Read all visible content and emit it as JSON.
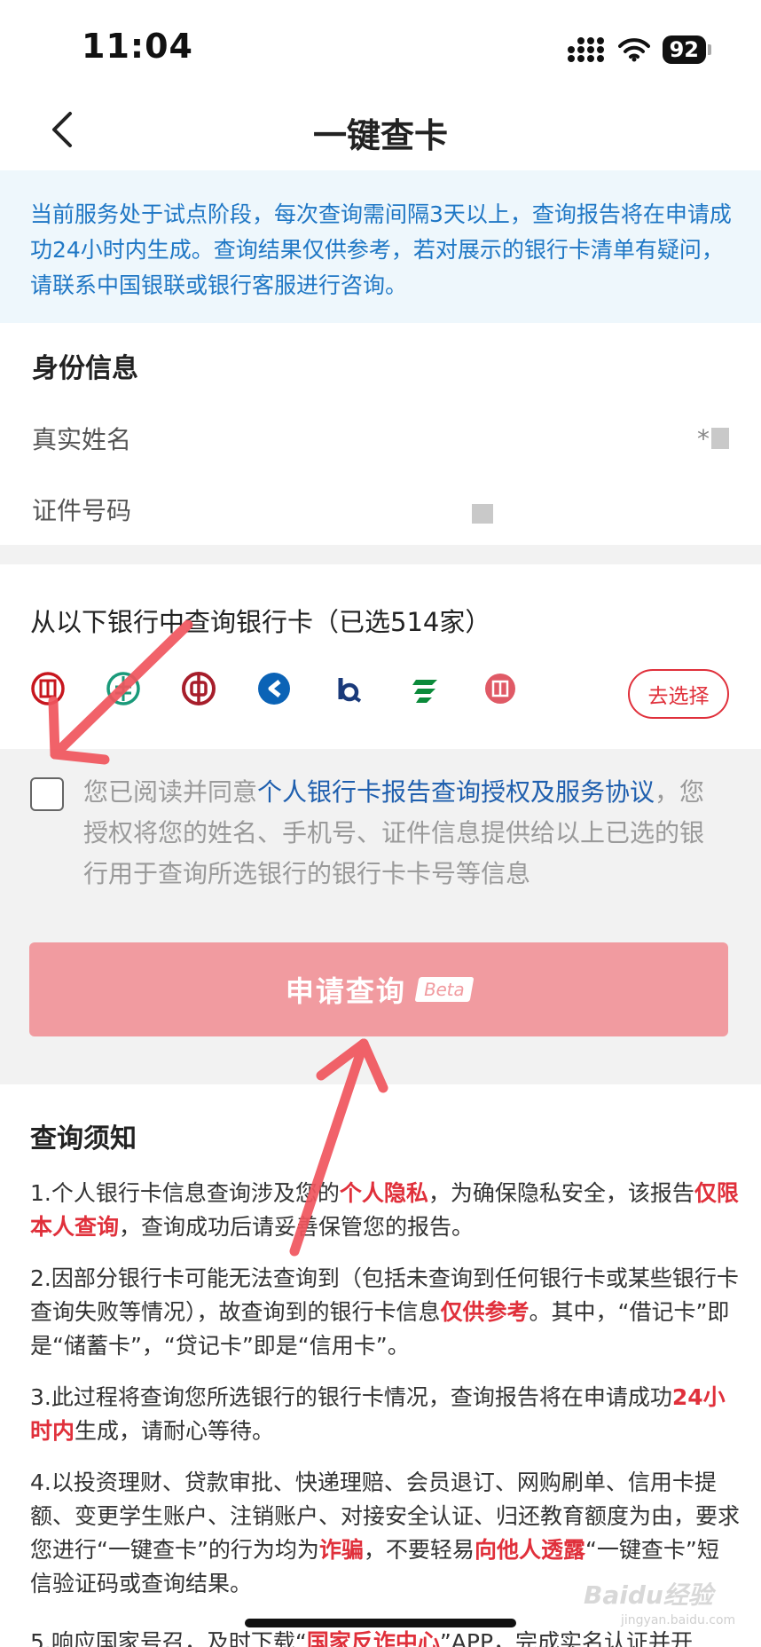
{
  "status_bar": {
    "time": "11:04",
    "battery": "92"
  },
  "nav": {
    "title": "一键查卡"
  },
  "notice": {
    "text": "当前服务处于试点阶段，每次查询需间隔3天以上，查询报告将在申请成功24小时内生成。查询结果仅供参考，若对展示的银行卡清单有疑问，请联系中国银联或银行客服进行咨询。"
  },
  "identity": {
    "title": "身份信息",
    "name_label": "真实姓名",
    "name_value": "*",
    "id_label": "证件号码"
  },
  "banks": {
    "title": "从以下银行中查询银行卡（已选514家）",
    "choose_label": "去选择",
    "logos": [
      {
        "icon": "icbc-logo-icon",
        "color": "#c7161e"
      },
      {
        "icon": "abc-logo-icon",
        "color": "#1a9a7a"
      },
      {
        "icon": "boc-logo-icon",
        "color": "#a71e2b"
      },
      {
        "icon": "ccb-logo-icon",
        "color": "#0b63b6"
      },
      {
        "icon": "bocom-logo-icon",
        "color": "#1a3a7a"
      },
      {
        "icon": "psbc-logo-icon",
        "color": "#0b8a3a"
      },
      {
        "icon": "citic-logo-icon",
        "color": "#e05a66"
      }
    ]
  },
  "agreement": {
    "prefix": "您已阅读并同意",
    "link": "个人银行卡报告查询授权及服务协议",
    "suffix": "，您授权将您的姓名、手机号、证件信息提供给以上已选的银行用于查询所选银行的银行卡卡号等信息"
  },
  "submit": {
    "label": "申请查询",
    "badge": "Beta"
  },
  "tips": {
    "title": "查询须知",
    "t1": {
      "a": "1.个人银行卡信息查询涉及您的",
      "b": "个人隐私",
      "c": "，为确保隐私安全，该报告",
      "d": "仅限本人查询",
      "e": "，查询成功后请妥善保管您的报告。"
    },
    "t2": {
      "a": "2.因部分银行卡可能无法查询到（包括未查询到任何银行卡或某些银行卡查询失败等情况），故查询到的银行卡信息",
      "b": "仅供参考",
      "c": "。其中，“借记卡”即是“储蓄卡”，“贷记卡”即是“信用卡”。"
    },
    "t3": {
      "a": "3.此过程将查询您所选银行的银行卡情况，查询报告将在申请成功",
      "b": "24小时内",
      "c": "生成，请耐心等待。"
    },
    "t4": {
      "a": "4.以投资理财、贷款审批、快递理赔、会员退订、网购刷单、信用卡提额、变更学生账户、注销账户、对接安全认证、归还教育额度为由，要求您进行“一键查卡”的行为均为",
      "b": "诈骗",
      "c": "，不要轻易",
      "d": "向他人透露",
      "e": "“一键查卡”短信验证码或查询结果。"
    },
    "t5": {
      "a": "5.响应国家号召，及时下载“",
      "b": "国家反诈中心",
      "c": "”APP，完成实名认证并开"
    }
  },
  "watermark": {
    "text": "Baidu经验",
    "sub": "jingyan.baidu.com"
  },
  "colors": {
    "accent_red": "#e0303b",
    "link_blue": "#1f5fae",
    "notice_blue": "#1f77c5",
    "button_pink": "#f19ba0",
    "arrow": "#f0555d"
  }
}
